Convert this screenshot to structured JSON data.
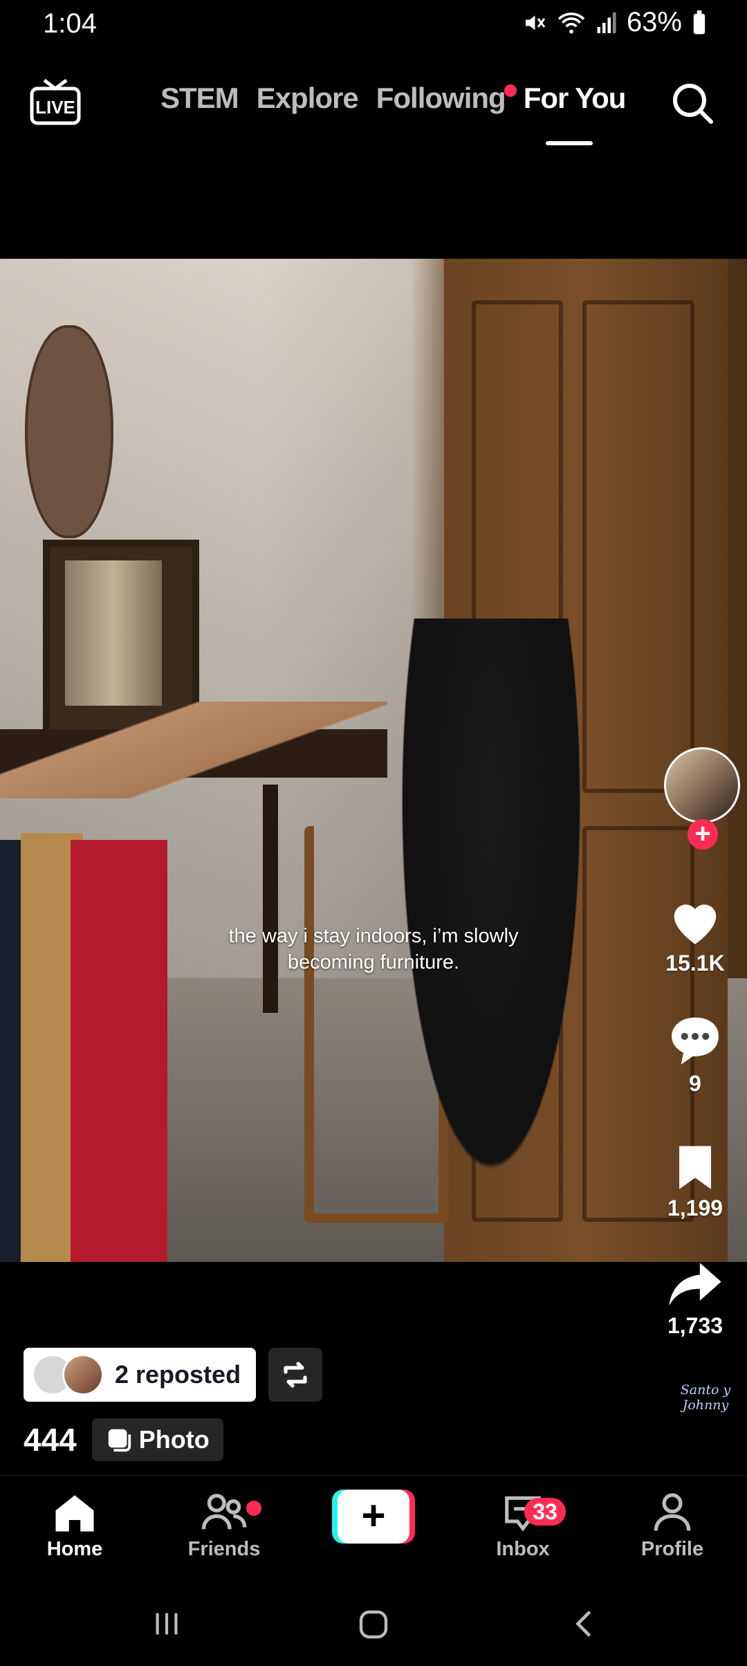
{
  "status": {
    "time": "1:04",
    "battery": "63%"
  },
  "topnav": {
    "live_icon": "live-tv-icon",
    "tabs": [
      "STEM",
      "Explore",
      "Following",
      "For You"
    ],
    "active_tab": "For You",
    "search_icon": "search-icon"
  },
  "post": {
    "caption": "the way i stay indoors, i’m slowly becoming furniture.",
    "likes": "15.1K",
    "comments": "9",
    "saves": "1,199",
    "shares": "1,733",
    "music_brand": "Santo y Johnny"
  },
  "repost": {
    "label": "2 reposted"
  },
  "meta": {
    "count": "444",
    "type_label": "Photo"
  },
  "bottomnav": {
    "home": "Home",
    "friends": "Friends",
    "inbox": "Inbox",
    "inbox_badge": "33",
    "profile": "Profile"
  },
  "colors": {
    "accent": "#fe2c55",
    "cyan": "#25f4ee"
  }
}
